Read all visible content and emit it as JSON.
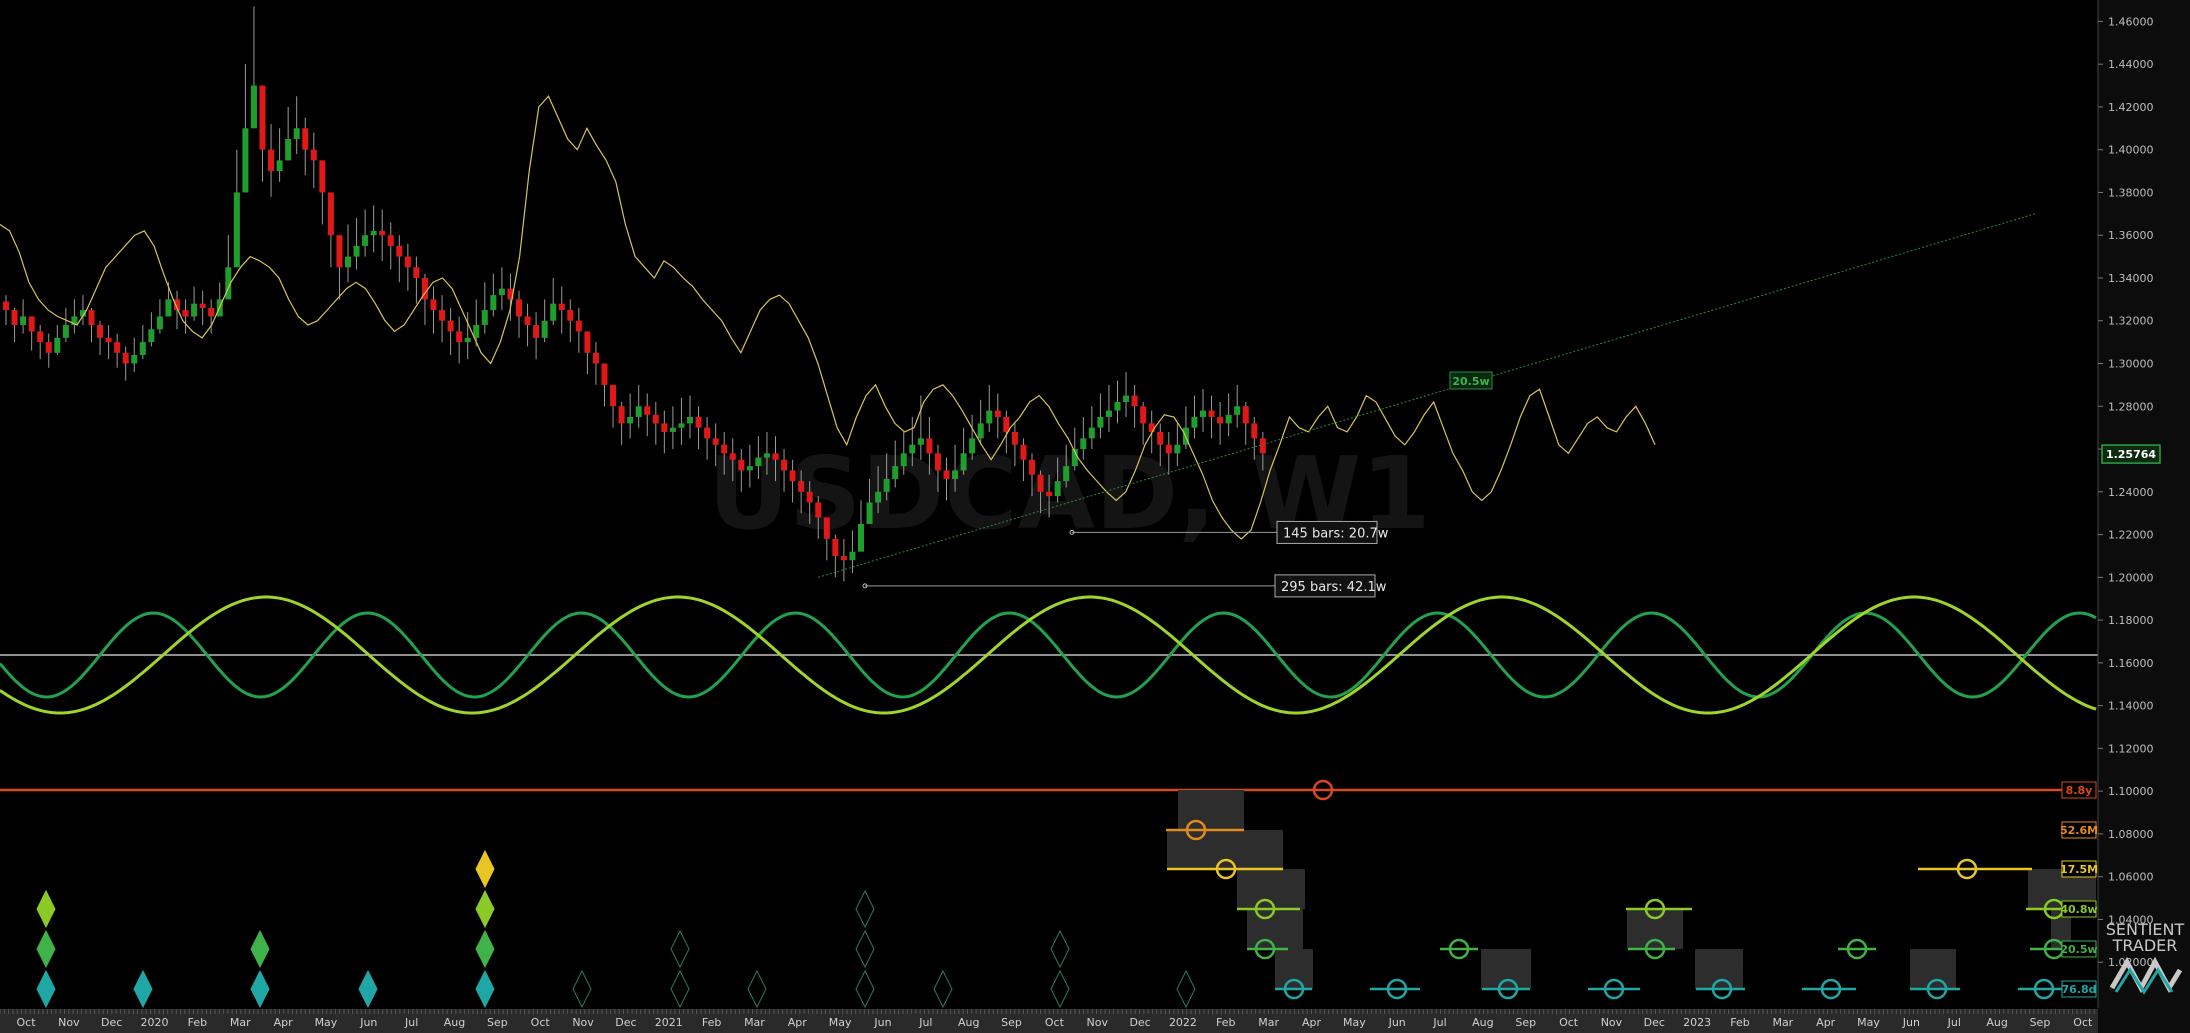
{
  "chart_data": {
    "type": "candlestick",
    "symbol_watermark": "USDCAD, W1",
    "last_price": "1.25764",
    "ylim": [
      1.0,
      1.47
    ],
    "price_ticks": [
      "1.46000",
      "1.44000",
      "1.42000",
      "1.40000",
      "1.38000",
      "1.36000",
      "1.34000",
      "1.32000",
      "1.30000",
      "1.28000",
      "1.26000",
      "1.24000",
      "1.22000",
      "1.20000",
      "1.18000",
      "1.16000",
      "1.14000",
      "1.12000",
      "1.10000",
      "1.08000",
      "1.06000",
      "1.04000",
      "1.02000"
    ],
    "time_labels": [
      "Oct",
      "Nov",
      "Dec",
      "2020",
      "Feb",
      "Mar",
      "Apr",
      "May",
      "Jun",
      "Jul",
      "Aug",
      "Sep",
      "Oct",
      "Nov",
      "Dec",
      "2021",
      "Feb",
      "Mar",
      "Apr",
      "May",
      "Jun",
      "Jul",
      "Aug",
      "Sep",
      "Oct",
      "Nov",
      "Dec",
      "2022",
      "Feb",
      "Mar",
      "Apr",
      "May",
      "Jun",
      "Jul",
      "Aug",
      "Sep",
      "Oct",
      "Nov",
      "Dec",
      "2023",
      "Feb",
      "Mar",
      "Apr",
      "May",
      "Jun",
      "Jul",
      "Aug",
      "Sep",
      "Oct"
    ],
    "closes": [
      1.325,
      1.318,
      1.322,
      1.315,
      1.31,
      1.305,
      1.312,
      1.318,
      1.322,
      1.325,
      1.318,
      1.312,
      1.31,
      1.305,
      1.3,
      1.304,
      1.31,
      1.316,
      1.322,
      1.33,
      1.325,
      1.322,
      1.328,
      1.326,
      1.322,
      1.33,
      1.345,
      1.38,
      1.41,
      1.43,
      1.4,
      1.39,
      1.395,
      1.405,
      1.41,
      1.4,
      1.395,
      1.38,
      1.36,
      1.345,
      1.35,
      1.355,
      1.36,
      1.362,
      1.36,
      1.355,
      1.35,
      1.345,
      1.34,
      1.33,
      1.325,
      1.32,
      1.315,
      1.31,
      1.312,
      1.318,
      1.325,
      1.332,
      1.335,
      1.33,
      1.322,
      1.318,
      1.312,
      1.32,
      1.328,
      1.325,
      1.32,
      1.315,
      1.305,
      1.3,
      1.29,
      1.28,
      1.272,
      1.275,
      1.28,
      1.276,
      1.272,
      1.268,
      1.27,
      1.272,
      1.275,
      1.27,
      1.265,
      1.262,
      1.258,
      1.255,
      1.25,
      1.252,
      1.256,
      1.258,
      1.255,
      1.25,
      1.245,
      1.24,
      1.235,
      1.228,
      1.218,
      1.21,
      1.208,
      1.212,
      1.225,
      1.235,
      1.24,
      1.246,
      1.252,
      1.258,
      1.262,
      1.265,
      1.258,
      1.25,
      1.246,
      1.25,
      1.258,
      1.265,
      1.272,
      1.278,
      1.275,
      1.268,
      1.262,
      1.255,
      1.248,
      1.24,
      1.238,
      1.245,
      1.252,
      1.26,
      1.265,
      1.27,
      1.275,
      1.278,
      1.282,
      1.285,
      1.28,
      1.272,
      1.268,
      1.262,
      1.258,
      1.262,
      1.27,
      1.275,
      1.278,
      1.275,
      1.272,
      1.276,
      1.28,
      1.272,
      1.265,
      1.258
    ],
    "highs": [
      1.332,
      1.326,
      1.33,
      1.322,
      1.318,
      1.314,
      1.318,
      1.326,
      1.33,
      1.332,
      1.326,
      1.32,
      1.318,
      1.314,
      1.308,
      1.312,
      1.318,
      1.324,
      1.33,
      1.338,
      1.334,
      1.33,
      1.336,
      1.334,
      1.33,
      1.338,
      1.36,
      1.4,
      1.44,
      1.467,
      1.428,
      1.412,
      1.41,
      1.42,
      1.425,
      1.415,
      1.408,
      1.395,
      1.375,
      1.36,
      1.365,
      1.368,
      1.372,
      1.374,
      1.372,
      1.366,
      1.36,
      1.356,
      1.35,
      1.342,
      1.336,
      1.332,
      1.326,
      1.322,
      1.324,
      1.33,
      1.338,
      1.342,
      1.345,
      1.342,
      1.334,
      1.328,
      1.324,
      1.33,
      1.34,
      1.336,
      1.33,
      1.326,
      1.315,
      1.31,
      1.3,
      1.29,
      1.282,
      1.286,
      1.29,
      1.286,
      1.282,
      1.278,
      1.28,
      1.284,
      1.285,
      1.28,
      1.275,
      1.272,
      1.268,
      1.265,
      1.26,
      1.262,
      1.266,
      1.268,
      1.266,
      1.26,
      1.255,
      1.25,
      1.245,
      1.238,
      1.228,
      1.22,
      1.218,
      1.222,
      1.236,
      1.246,
      1.252,
      1.258,
      1.264,
      1.268,
      1.275,
      1.285,
      1.275,
      1.262,
      1.256,
      1.262,
      1.27,
      1.276,
      1.283,
      1.29,
      1.286,
      1.278,
      1.272,
      1.265,
      1.258,
      1.25,
      1.248,
      1.256,
      1.262,
      1.27,
      1.275,
      1.28,
      1.286,
      1.29,
      1.292,
      1.296,
      1.29,
      1.282,
      1.278,
      1.272,
      1.268,
      1.272,
      1.28,
      1.285,
      1.288,
      1.285,
      1.282,
      1.286,
      1.29,
      1.282,
      1.275,
      1.268
    ],
    "lows": [
      1.318,
      1.31,
      1.314,
      1.306,
      1.302,
      1.298,
      1.304,
      1.31,
      1.314,
      1.318,
      1.31,
      1.304,
      1.302,
      1.298,
      1.292,
      1.296,
      1.302,
      1.308,
      1.314,
      1.322,
      1.316,
      1.314,
      1.32,
      1.318,
      1.314,
      1.322,
      1.335,
      1.36,
      1.395,
      1.41,
      1.385,
      1.378,
      1.385,
      1.395,
      1.398,
      1.388,
      1.382,
      1.365,
      1.345,
      1.33,
      1.338,
      1.344,
      1.35,
      1.352,
      1.348,
      1.344,
      1.338,
      1.334,
      1.328,
      1.318,
      1.314,
      1.31,
      1.304,
      1.3,
      1.302,
      1.308,
      1.314,
      1.322,
      1.325,
      1.32,
      1.312,
      1.308,
      1.302,
      1.31,
      1.318,
      1.314,
      1.31,
      1.305,
      1.295,
      1.29,
      1.28,
      1.27,
      1.262,
      1.265,
      1.27,
      1.266,
      1.262,
      1.258,
      1.26,
      1.262,
      1.265,
      1.26,
      1.255,
      1.252,
      1.248,
      1.245,
      1.24,
      1.242,
      1.246,
      1.248,
      1.245,
      1.24,
      1.235,
      1.23,
      1.225,
      1.218,
      1.208,
      1.2,
      1.198,
      1.202,
      1.215,
      1.225,
      1.23,
      1.236,
      1.242,
      1.248,
      1.252,
      1.255,
      1.248,
      1.24,
      1.236,
      1.24,
      1.248,
      1.255,
      1.262,
      1.268,
      1.265,
      1.258,
      1.252,
      1.245,
      1.238,
      1.23,
      1.228,
      1.235,
      1.242,
      1.25,
      1.255,
      1.26,
      1.265,
      1.268,
      1.272,
      1.275,
      1.27,
      1.262,
      1.258,
      1.252,
      1.248,
      1.252,
      1.26,
      1.265,
      1.268,
      1.265,
      1.262,
      1.266,
      1.27,
      1.262,
      1.255,
      1.25
    ],
    "projection": [
      1.365,
      1.362,
      1.352,
      1.338,
      1.33,
      1.325,
      1.322,
      1.32,
      1.318,
      1.325,
      1.335,
      1.345,
      1.35,
      1.355,
      1.36,
      1.362,
      1.355,
      1.342,
      1.33,
      1.32,
      1.315,
      1.312,
      1.318,
      1.328,
      1.338,
      1.345,
      1.35,
      1.348,
      1.345,
      1.34,
      1.33,
      1.322,
      1.318,
      1.32,
      1.325,
      1.33,
      1.335,
      1.338,
      1.335,
      1.328,
      1.32,
      1.315,
      1.318,
      1.325,
      1.332,
      1.338,
      1.34,
      1.335,
      1.325,
      1.315,
      1.305,
      1.3,
      1.31,
      1.325,
      1.35,
      1.39,
      1.42,
      1.425,
      1.415,
      1.405,
      1.4,
      1.41,
      1.402,
      1.395,
      1.385,
      1.365,
      1.35,
      1.345,
      1.34,
      1.348,
      1.345,
      1.34,
      1.336,
      1.33,
      1.325,
      1.32,
      1.312,
      1.305,
      1.315,
      1.325,
      1.33,
      1.332,
      1.328,
      1.32,
      1.312,
      1.3,
      1.285,
      1.27,
      1.262,
      1.275,
      1.285,
      1.29,
      1.28,
      1.272,
      1.268,
      1.27,
      1.282,
      1.288,
      1.29,
      1.285,
      1.278,
      1.27,
      1.262,
      1.255,
      1.262,
      1.27,
      1.275,
      1.282,
      1.285,
      1.28,
      1.272,
      1.265,
      1.256,
      1.25,
      1.245,
      1.24,
      1.236,
      1.24,
      1.25,
      1.262,
      1.27,
      1.276,
      1.275,
      1.268,
      1.258,
      1.248,
      1.236,
      1.228,
      1.222,
      1.218,
      1.222,
      1.235,
      1.25,
      1.262,
      1.275,
      1.27,
      1.268,
      1.275,
      1.28,
      1.27,
      1.268,
      1.275,
      1.285,
      1.282,
      1.274,
      1.266,
      1.262,
      1.268,
      1.276,
      1.282,
      1.27,
      1.258,
      1.25,
      1.24,
      1.236,
      1.24,
      1.25,
      1.262,
      1.275,
      1.285,
      1.288,
      1.275,
      1.262,
      1.258,
      1.265,
      1.272,
      1.275,
      1.27,
      1.268,
      1.275,
      1.28,
      1.272,
      1.262
    ],
    "trendline": {
      "from_index": 95,
      "from_price": 1.2,
      "to_index": 190,
      "to_price": 1.37
    },
    "annotations": [
      {
        "label": "145 bars: 20.7w",
        "price": 1.221
      },
      {
        "label": "295 bars: 42.1w",
        "price": 1.196
      }
    ],
    "trend_tag": "20.5w",
    "cycle_tags": [
      {
        "label": "8.8y",
        "color": "#d9491a"
      },
      {
        "label": "52.6M",
        "color": "#e38a1e"
      },
      {
        "label": "17.5M",
        "color": "#e7c623"
      },
      {
        "label": "40.8w",
        "color": "#8ac926"
      },
      {
        "label": "20.5w",
        "color": "#3fb24a"
      },
      {
        "label": "76.8d",
        "color": "#1fa7a6"
      }
    ]
  }
}
